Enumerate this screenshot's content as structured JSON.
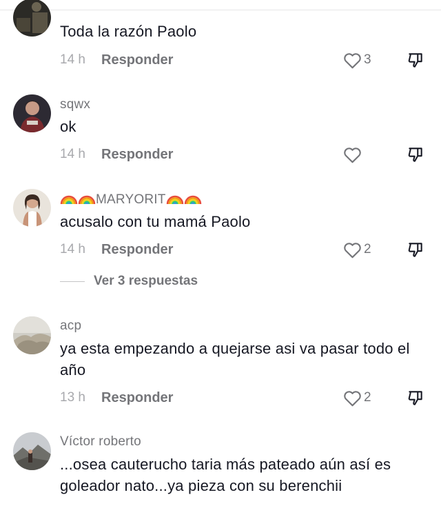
{
  "comments": [
    {
      "username": "",
      "text": "Toda la razón Paolo",
      "time": "14 h",
      "reply_label": "Responder",
      "likes": "3"
    },
    {
      "username": "sqwx",
      "text": "ok",
      "time": "14 h",
      "reply_label": "Responder",
      "likes": ""
    },
    {
      "username": "MARYORIT",
      "text": "acusalo con tu mamá Paolo",
      "time": "14 h",
      "reply_label": "Responder",
      "likes": "2",
      "view_replies": "Ver 3 respuestas"
    },
    {
      "username": "acp",
      "text": "ya esta empezando a quejarse asi va pasar todo el año",
      "time": "13 h",
      "reply_label": "Responder",
      "likes": "2"
    },
    {
      "username": "Víctor roberto",
      "text": "...osea cauterucho taria más pateado aún así es goleador nato...ya pieza con su berenchii"
    }
  ],
  "colors": {
    "text_primary": "#161823",
    "text_secondary": "#747579",
    "text_muted": "#a8a9ad"
  },
  "icons": [
    "heart-outline-icon",
    "dislike-icon",
    "rainbow-emoji-icon"
  ]
}
